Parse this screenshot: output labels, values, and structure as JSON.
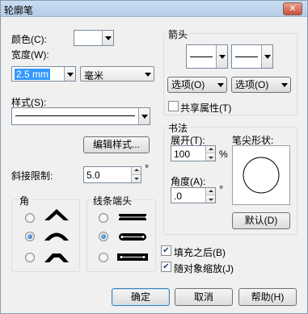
{
  "window": {
    "title": "轮廓笔",
    "close_glyph": "✕"
  },
  "left": {
    "color_label": "颜色(C):",
    "width_label": "宽度(W):",
    "width_value": "2.5 mm",
    "unit_value": "毫米",
    "style_label": "样式(S):",
    "edit_style_button": "编辑样式...",
    "miter_label": "斜接限制:",
    "miter_value": "5.0",
    "miter_unit": "°"
  },
  "corners": {
    "title": "角",
    "options": [
      {
        "name": "miter-corner",
        "selected": false
      },
      {
        "name": "round-corner",
        "selected": true
      },
      {
        "name": "bevel-corner",
        "selected": false
      }
    ]
  },
  "line_caps": {
    "title": "线条端头",
    "options": [
      {
        "name": "butt-cap",
        "selected": false
      },
      {
        "name": "round-cap",
        "selected": true
      },
      {
        "name": "square-cap",
        "selected": false
      }
    ]
  },
  "arrows": {
    "title": "箭头",
    "options_left": "选项(O)",
    "options_right": "选项(O)",
    "share_label": "共享属性(T)",
    "share_checked": false
  },
  "calligraphy": {
    "title": "书法",
    "stretch_label": "展开(T):",
    "stretch_value": "100",
    "stretch_unit": "%",
    "angle_label": "角度(A):",
    "angle_value": ".0",
    "angle_unit": "°",
    "nib_label": "笔尖形状:",
    "default_button": "默认(D)"
  },
  "options": {
    "behind_fill_label": "填充之后(B)",
    "behind_fill_checked": true,
    "scale_label": "随对象缩放(J)",
    "scale_checked": true
  },
  "footer": {
    "ok": "确定",
    "cancel": "取消",
    "help": "帮助(H)"
  },
  "colors": {
    "selection": "#3399ff",
    "dialog_bg": "#f0f0f0",
    "default_button_border": "#3c7fb1"
  }
}
